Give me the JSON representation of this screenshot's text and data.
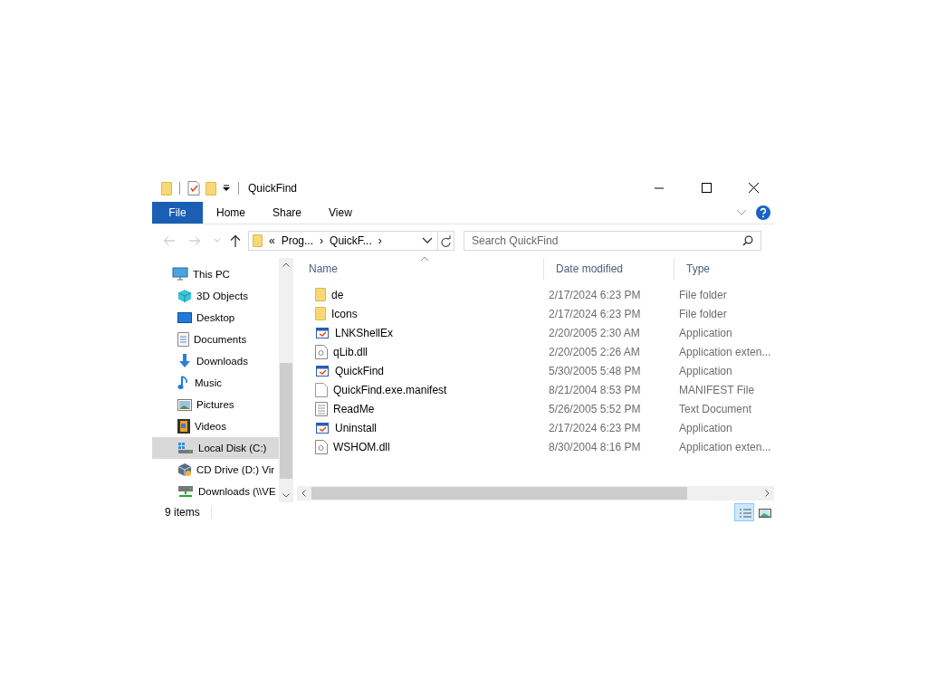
{
  "window": {
    "title": "QuickFind"
  },
  "ribbon": {
    "tabs": [
      {
        "label": "File",
        "selected": true
      },
      {
        "label": "Home",
        "selected": false
      },
      {
        "label": "Share",
        "selected": false
      },
      {
        "label": "View",
        "selected": false
      }
    ]
  },
  "address": {
    "crumbs": [
      "«",
      "Prog...",
      "›",
      "QuickF...",
      "›"
    ]
  },
  "search": {
    "placeholder": "Search QuickFind"
  },
  "sidebar": {
    "items": [
      {
        "label": "This PC",
        "selected": false,
        "children": [
          {
            "label": "3D Objects",
            "selected": false
          },
          {
            "label": "Desktop",
            "selected": false
          },
          {
            "label": "Documents",
            "selected": false
          },
          {
            "label": "Downloads",
            "selected": false
          },
          {
            "label": "Music",
            "selected": false
          },
          {
            "label": "Pictures",
            "selected": false
          },
          {
            "label": "Videos",
            "selected": false
          },
          {
            "label": "Local Disk (C:)",
            "selected": true
          },
          {
            "label": "CD Drive (D:) Vir",
            "selected": false
          },
          {
            "label": "Downloads (\\\\VE",
            "selected": false
          }
        ]
      }
    ]
  },
  "table": {
    "columns": [
      {
        "label": "Name",
        "sorted": true
      },
      {
        "label": "Date modified",
        "sorted": false
      },
      {
        "label": "Type",
        "sorted": false
      }
    ],
    "rows": [
      {
        "kind": "folder",
        "name": "de",
        "date": "2/17/2024 6:23 PM",
        "type": "File folder"
      },
      {
        "kind": "folder",
        "name": "Icons",
        "date": "2/17/2024 6:23 PM",
        "type": "File folder"
      },
      {
        "kind": "app",
        "name": "LNKShellEx",
        "date": "2/20/2005 2:30 AM",
        "type": "Application"
      },
      {
        "kind": "dll",
        "name": "qLib.dll",
        "date": "2/20/2005 2:26 AM",
        "type": "Application exten..."
      },
      {
        "kind": "app",
        "name": "QuickFind",
        "date": "5/30/2005 5:48 PM",
        "type": "Application"
      },
      {
        "kind": "blank",
        "name": "QuickFind.exe.manifest",
        "date": "8/21/2004 8:53 PM",
        "type": "MANIFEST File"
      },
      {
        "kind": "text",
        "name": "ReadMe",
        "date": "5/26/2005 5:52 PM",
        "type": "Text Document"
      },
      {
        "kind": "app",
        "name": "Uninstall",
        "date": "2/17/2024 6:23 PM",
        "type": "Application"
      },
      {
        "kind": "dll",
        "name": "WSHOM.dll",
        "date": "8/30/2004 8:16 PM",
        "type": "Application exten..."
      }
    ]
  },
  "status_bar": {
    "count": "9 items",
    "views": [
      {
        "selected": true
      },
      {
        "selected": false
      }
    ]
  }
}
